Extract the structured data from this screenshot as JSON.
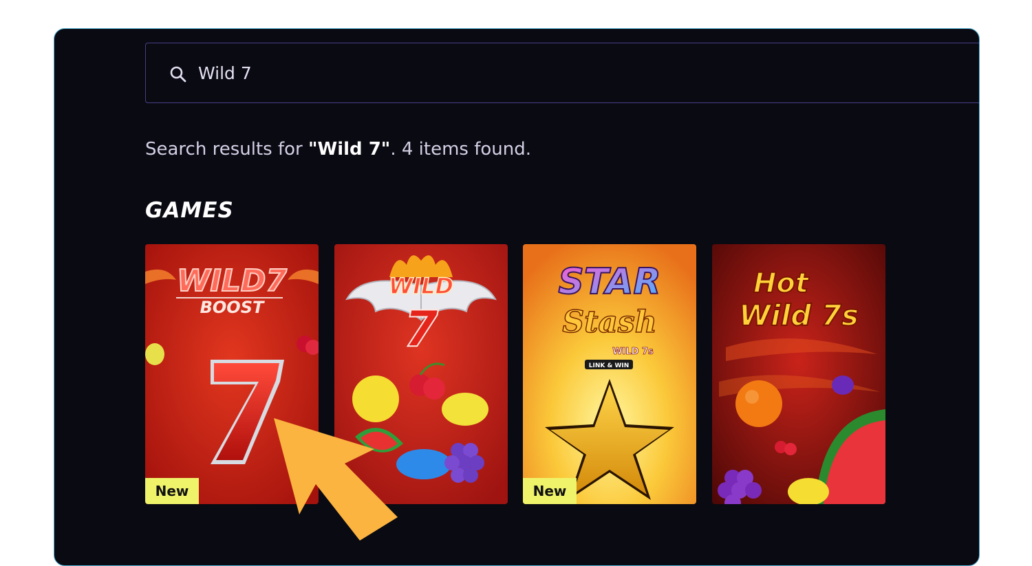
{
  "search": {
    "value": "Wild 7",
    "icon": "search-icon"
  },
  "results": {
    "prefix": "Search results for ",
    "query": "\"Wild 7\"",
    "suffix": ". 4 items found."
  },
  "section": {
    "title": "GAMES"
  },
  "games": [
    {
      "logo_line1": "WILD7",
      "logo_line2": "BOOST",
      "badge": "New"
    },
    {
      "logo_line1": "WILD",
      "logo_line2": "7",
      "badge": ""
    },
    {
      "logo_line1": "STAR",
      "logo_line2": "Stash",
      "logo_sub": "WILD 7s",
      "logo_tag": "LINK & WIN",
      "badge": "New"
    },
    {
      "logo_line1": "Hot",
      "logo_line2": "Wild 7s",
      "badge": ""
    }
  ],
  "colors": {
    "panel_bg": "#0a0a12",
    "accent_border": "#4a3f86",
    "badge_bg": "#eff36a",
    "arrow": "#fbb440"
  }
}
